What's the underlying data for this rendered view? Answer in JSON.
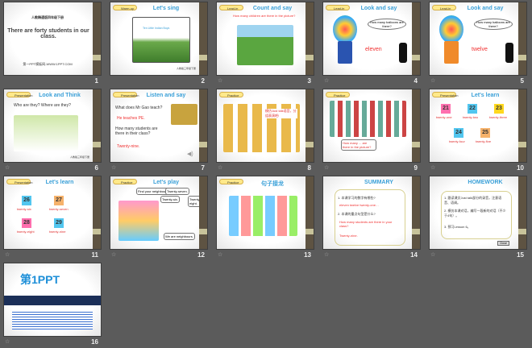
{
  "slides": [
    {
      "n": "1",
      "book": "人教精通版四年级下册",
      "title": "There are forty students in our class.",
      "site": "第一PPT模板网-WWW.1PPT.COM"
    },
    {
      "n": "2",
      "badge": "Warm-up",
      "title": "Let's sing",
      "song": "Ten Little Indian Boys",
      "note": "人教版三年级下册"
    },
    {
      "n": "3",
      "badge": "Lead-in",
      "title": "Count and say",
      "question": "How many children are there in the picture?"
    },
    {
      "n": "4",
      "badge": "Lead-in",
      "title": "Look and say",
      "bubble": "How many balloons are there?",
      "answer": "eleven"
    },
    {
      "n": "5",
      "badge": "Lead-in",
      "title": "Look and say",
      "bubble": "How many balloons are there?",
      "answer": "twelve"
    },
    {
      "n": "6",
      "badge": "Presentation",
      "title": "Look and Think",
      "question": "Who are they? Where are they?",
      "note": "人教版三年级下册"
    },
    {
      "n": "7",
      "badge": "Presentation",
      "title": "Listen and say",
      "q1": "What does Mr Gao teach?",
      "a1": "He teaches PE.",
      "q2": "How many students are there in their class?",
      "a2": "Twenty-nine."
    },
    {
      "n": "8",
      "badge": "Practice",
      "text": "模仿Just talk语音，分组表演吧!"
    },
    {
      "n": "9",
      "badge": "Practice",
      "bubble": "How many ... are there in the picture?"
    },
    {
      "n": "10",
      "badge": "Presentation",
      "title": "Let's learn",
      "numbers": [
        {
          "v": "21",
          "w": "twenty-one",
          "c": "#ff6fae"
        },
        {
          "v": "22",
          "w": "twenty-two",
          "c": "#52c6ef"
        },
        {
          "v": "23",
          "w": "twenty-three",
          "c": "#ffd81e"
        },
        {
          "v": "24",
          "w": "twenty-four",
          "c": "#52c6ef"
        },
        {
          "v": "25",
          "w": "twenty-five",
          "c": "#f6b26b"
        }
      ]
    },
    {
      "n": "11",
      "badge": "Presentation",
      "title": "Let's learn",
      "numbers": [
        {
          "v": "26",
          "w": "twenty-six",
          "c": "#52c6ef"
        },
        {
          "v": "27",
          "w": "twenty-seven",
          "c": "#f6b26b"
        },
        {
          "v": "28",
          "w": "twenty-eight",
          "c": "#ff6fae"
        },
        {
          "v": "29",
          "w": "twenty-nine",
          "c": "#52c6ef"
        }
      ]
    },
    {
      "n": "12",
      "badge": "Practice",
      "title": "Let's play",
      "b1": "Find your neighbours.",
      "b2": "Twenty-seven.",
      "b3": "Twenty-six.",
      "b4": "Twenty-eight.",
      "b5": "We are neighbours."
    },
    {
      "n": "13",
      "badge": "Practice",
      "title": "句子接龙"
    },
    {
      "n": "14",
      "title": "SUMMARY",
      "q1": "1. 本课学习的数字有哪些?",
      "a1": "eleven  twelve  twenty-one…",
      "q2": "2. 本课的重点句型是什么?",
      "a2": "How many students are there in your class?",
      "a3": "Twenty-nine."
    },
    {
      "n": "15",
      "title": "HOMEWORK",
      "i1": "1. 跟读课文Just talk部分的录音，注意语音、语调。",
      "i2": "2. 模仿本课对话，编写一段新的对话（不少于4句）。",
      "i3": "3. 预习Lesson 6。",
      "btn": "Close"
    },
    {
      "n": "16",
      "logo": "第1PPT"
    }
  ]
}
